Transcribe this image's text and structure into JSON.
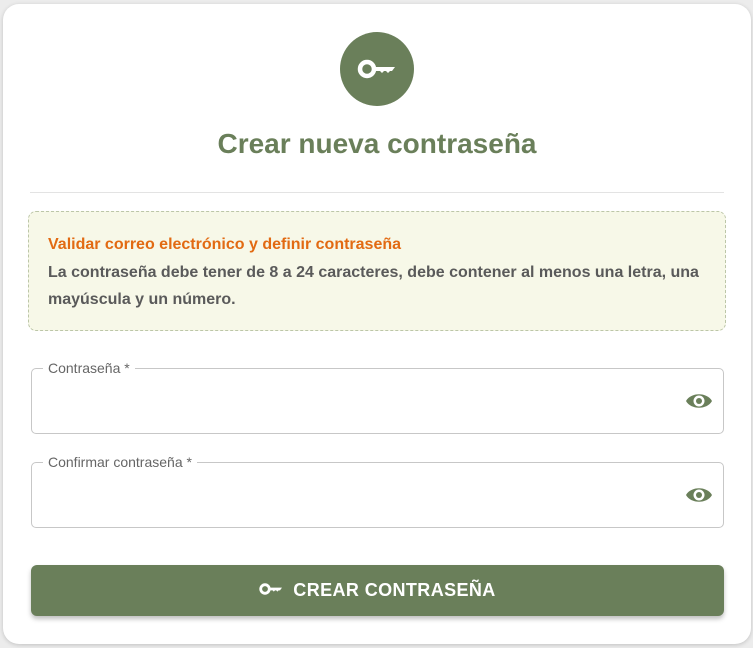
{
  "page": {
    "title": "Crear nueva contraseña",
    "logo_icon": "key-icon"
  },
  "notice": {
    "title": "Validar correo electrónico y definir contraseña",
    "text": "La contraseña debe tener de 8 a 24 caracteres, debe contener al menos una letra, una mayúscula y un número."
  },
  "form": {
    "password": {
      "label": "Contraseña *",
      "value": "",
      "icon": "eye-icon"
    },
    "confirm_password": {
      "label": "Confirmar contraseña *",
      "value": "",
      "icon": "eye-icon"
    },
    "submit": {
      "label": "CREAR CONTRASEÑA",
      "icon": "key-icon"
    }
  },
  "colors": {
    "accent": "#6a7f5a",
    "notice_title": "#e26a12",
    "notice_bg": "#f7f8e8"
  }
}
